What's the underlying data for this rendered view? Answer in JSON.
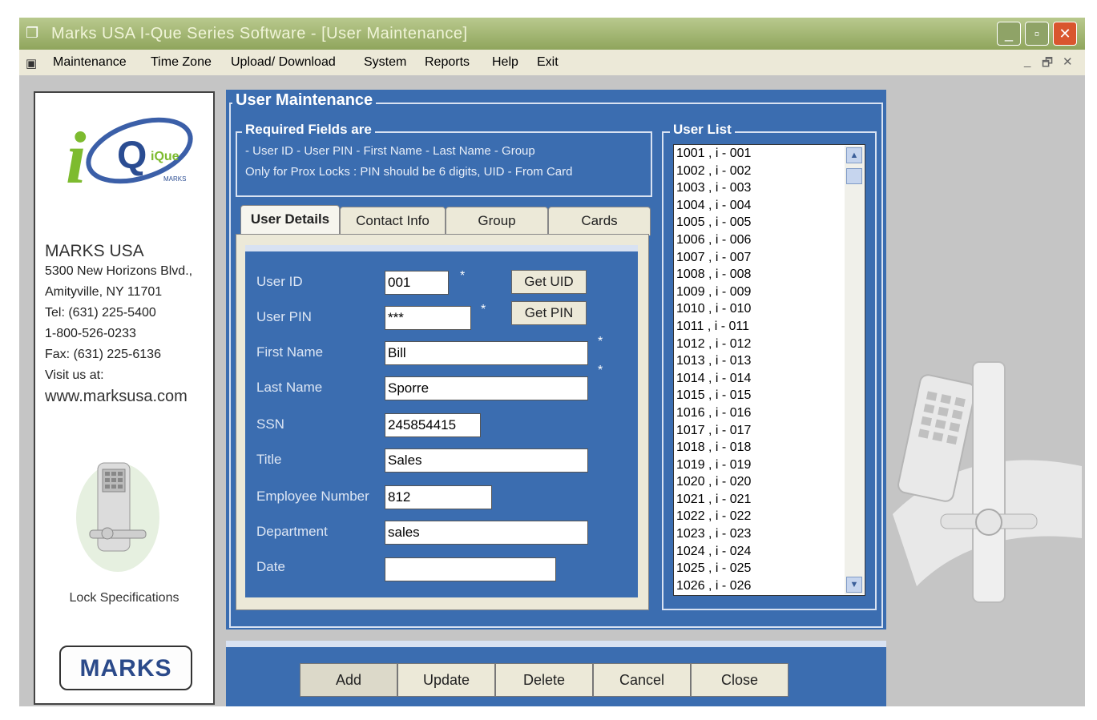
{
  "window": {
    "title": "Marks USA    I-Que Series Software - [User Maintenance]",
    "controls": {
      "minimize": "_",
      "maximize": "▫",
      "close": "✕"
    }
  },
  "menu": {
    "items": [
      "Maintenance",
      "Time Zone",
      "Upload/ Download",
      "System",
      "Reports",
      "Help",
      "Exit"
    ],
    "mdi_min": "_",
    "mdi_restore": "🗗",
    "mdi_close": "✕"
  },
  "sidebar": {
    "logo_text": "iQue",
    "logo_small": "MARKS",
    "company_name": "MARKS USA",
    "address1": "5300 New Horizons Blvd.,",
    "address2": "Amityville, NY 11701",
    "tel": "Tel: (631) 225-5400",
    "tollfree": "1-800-526-0233",
    "fax": "Fax: (631) 225-6136",
    "visit": "Visit us at:",
    "website": "www.marksusa.com",
    "lock_spec_label": "Lock Specifications",
    "bottom_logo": "MARKS"
  },
  "main": {
    "title": "User Maintenance",
    "required": {
      "legend": "Required Fields are",
      "line1": "- User ID   - User PIN   - First Name  - Last Name  - Group",
      "line2": "Only for Prox Locks : PIN should be 6 digits, UID - From Card"
    },
    "tabs": [
      "User Details",
      "Contact Info",
      "Group",
      "Cards"
    ],
    "fields": {
      "user_id": {
        "label": "User ID",
        "value": "001"
      },
      "user_pin": {
        "label": "User PIN",
        "value": "***"
      },
      "first_name": {
        "label": "First Name",
        "value": "Bill"
      },
      "last_name": {
        "label": "Last Name",
        "value": "Sporre"
      },
      "ssn": {
        "label": "SSN",
        "value": "245854415"
      },
      "title": {
        "label": "Title",
        "value": "Sales"
      },
      "employee_number": {
        "label": "Employee Number",
        "value": "812"
      },
      "department": {
        "label": "Department",
        "value": "sales"
      },
      "date": {
        "label": "Date",
        "value": ""
      }
    },
    "required_marker": "*",
    "get_uid_label": "Get UID",
    "get_pin_label": "Get PIN"
  },
  "user_list": {
    "legend": "User List",
    "items": [
      "1001 , i - 001",
      "1002 , i - 002",
      "1003 , i - 003",
      "1004 , i - 004",
      "1005 , i - 005",
      "1006 , i - 006",
      "1007 , i - 007",
      "1008 , i - 008",
      "1009 , i - 009",
      "1010 , i - 010",
      "1011 , i - 011",
      "1012 , i - 012",
      "1013 , i - 013",
      "1014 , i - 014",
      "1015 , i - 015",
      "1016 , i - 016",
      "1017 , i - 017",
      "1018 , i - 018",
      "1019 , i - 019",
      "1020 , i - 020",
      "1021 , i - 021",
      "1022 , i - 022",
      "1023 , i - 023",
      "1024 , i - 024",
      "1025 , i - 025",
      "1026 , i - 026"
    ]
  },
  "actions": [
    "Add",
    "Update",
    "Delete",
    "Cancel",
    "Close"
  ],
  "colors": {
    "panel_blue": "#3b6db0",
    "title_green": "#9db06c",
    "close_red": "#d9562e"
  }
}
